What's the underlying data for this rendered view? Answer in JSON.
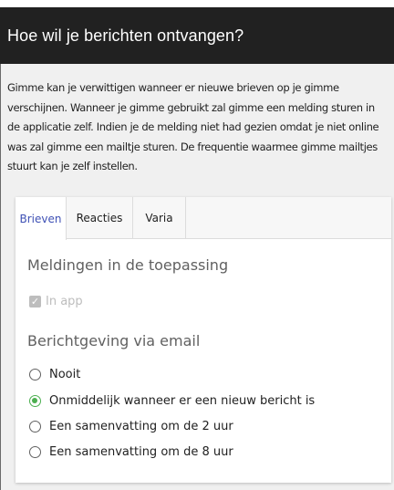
{
  "header": {
    "title": "Hoe wil je berichten ontvangen?"
  },
  "description": {
    "lines": [
      "Gimme kan je verwittigen wanneer er nieuwe brieven op je gimme",
      "verschijnen. Wanneer je gimme gebruikt zal gimme een melding sturen in",
      "de applicatie zelf. Indien je de melding niet had gezien omdat je niet online",
      "was zal gimme een mailtje sturen. De frequentie waarmee gimme mailtjes",
      "stuurt kan je zelf instellen."
    ]
  },
  "tabs": [
    {
      "label": "Brieven",
      "active": true
    },
    {
      "label": "Reacties",
      "active": false
    },
    {
      "label": "Varia",
      "active": false
    }
  ],
  "in_app_section": {
    "title": "Meldingen in de toepassing",
    "checkbox_label": "In app",
    "checkbox_checked": true,
    "checkbox_disabled": true
  },
  "email_section": {
    "title": "Berichtgeving via email",
    "options": [
      {
        "label": "Nooit",
        "selected": false
      },
      {
        "label": "Onmiddelijk wanneer er een nieuw bericht is",
        "selected": true
      },
      {
        "label": "Een samenvatting om de 2 uur",
        "selected": false
      },
      {
        "label": "Een samenvatting om de 8 uur",
        "selected": false
      }
    ]
  },
  "icons": {
    "checkbox_icon": "check-icon",
    "radio_icon": "radio-icon"
  },
  "colors": {
    "header_bg": "#212121",
    "active_tab": "#3f51b5",
    "selected_radio": "#4caf50",
    "disabled": "#bdbdbd"
  }
}
